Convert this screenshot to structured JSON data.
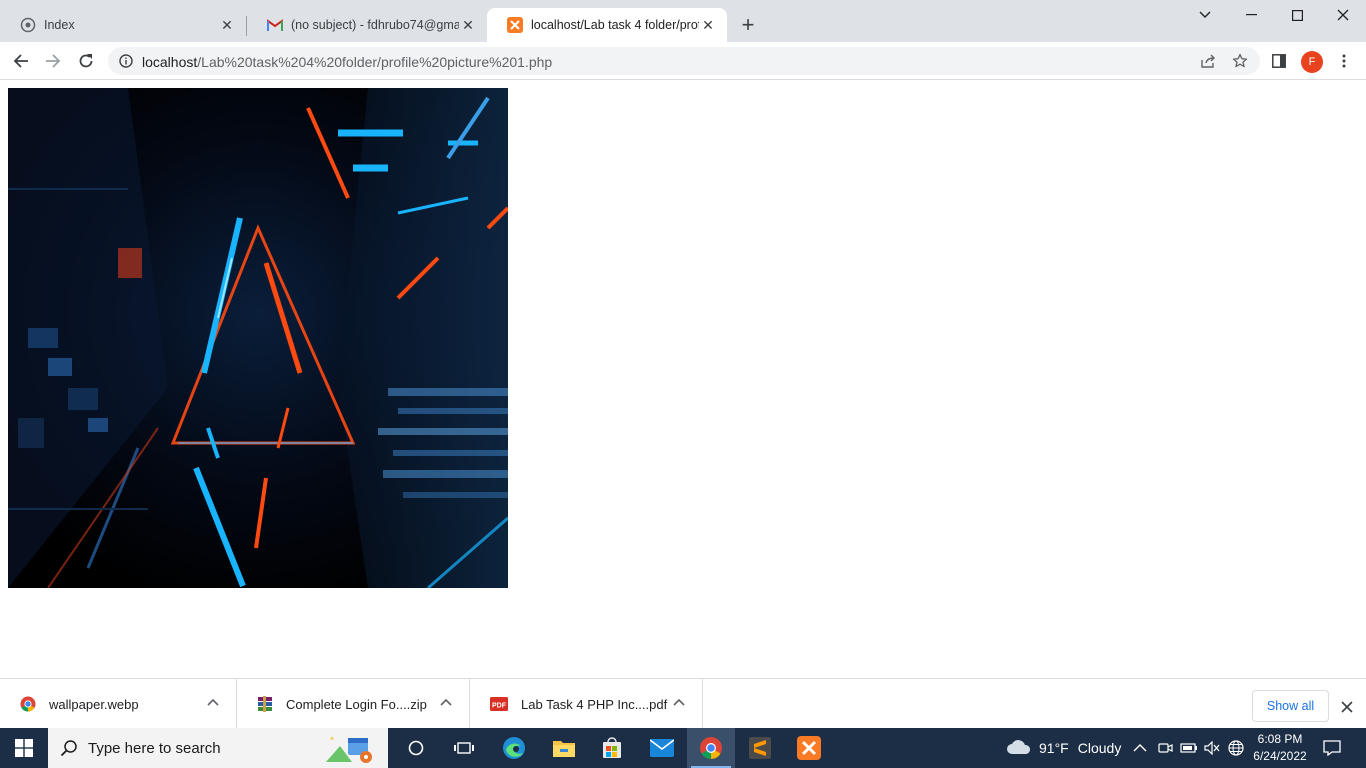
{
  "browser": {
    "tabs": [
      {
        "title": "Index",
        "favicon": "index-icon",
        "active": false
      },
      {
        "title": "(no subject) - fdhrubo74@gmail.c",
        "favicon": "gmail-icon",
        "active": false
      },
      {
        "title": "localhost/Lab task 4 folder/profile",
        "favicon": "xampp-icon",
        "active": true
      }
    ],
    "new_tab_label": "+",
    "address": {
      "host": "localhost",
      "path": "/Lab%20task%204%20folder/profile%20picture%201.php"
    },
    "profile_initial": "F"
  },
  "page": {
    "image": {
      "name": "wallpaper",
      "description_icon": "neon-tunnel-image"
    }
  },
  "downloads": {
    "items": [
      {
        "name": "wallpaper.webp",
        "icon": "chrome-icon"
      },
      {
        "name": "Complete Login Fo....zip",
        "icon": "winrar-icon"
      },
      {
        "name": "Lab Task 4 PHP Inc....pdf",
        "icon": "pdf-icon"
      }
    ],
    "show_all_label": "Show all",
    "pdf_badge": "PDF"
  },
  "taskbar": {
    "search_placeholder": "Type here to search",
    "weather_temp": "91°F",
    "weather_text": "Cloudy",
    "time": "6:08 PM",
    "date": "6/24/2022"
  },
  "colors": {
    "tabstrip": "#dee1e6",
    "accent_blue": "#1a73e8",
    "taskbar": "#1c2e45",
    "avatar": "#e8431f"
  }
}
